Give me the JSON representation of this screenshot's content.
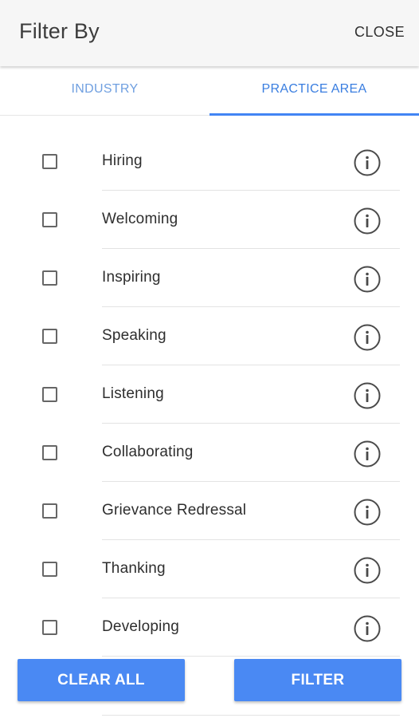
{
  "header": {
    "title": "Filter By",
    "close_label": "CLOSE"
  },
  "tabs": [
    {
      "label": "INDUSTRY",
      "active": false
    },
    {
      "label": "PRACTICE AREA",
      "active": true
    }
  ],
  "options": [
    {
      "label": "Hiring",
      "checked": false,
      "icon": "info-icon"
    },
    {
      "label": "Welcoming",
      "checked": false,
      "icon": "info-icon"
    },
    {
      "label": "Inspiring",
      "checked": false,
      "icon": "info-icon"
    },
    {
      "label": "Speaking",
      "checked": false,
      "icon": "info-icon"
    },
    {
      "label": "Listening",
      "checked": false,
      "icon": "info-icon"
    },
    {
      "label": "Collaborating",
      "checked": false,
      "icon": "info-icon"
    },
    {
      "label": "Grievance Redressal",
      "checked": false,
      "icon": "info-icon"
    },
    {
      "label": "Thanking",
      "checked": false,
      "icon": "info-icon"
    },
    {
      "label": "Developing",
      "checked": false,
      "icon": "info-icon"
    }
  ],
  "actions": {
    "clear_all_label": "CLEAR ALL",
    "filter_label": "FILTER"
  },
  "colors": {
    "accent": "#4285f4",
    "active_tab_text": "#3a7ee0",
    "inactive_tab_text": "#6f9fe0",
    "button_bg": "#4a89f3"
  }
}
